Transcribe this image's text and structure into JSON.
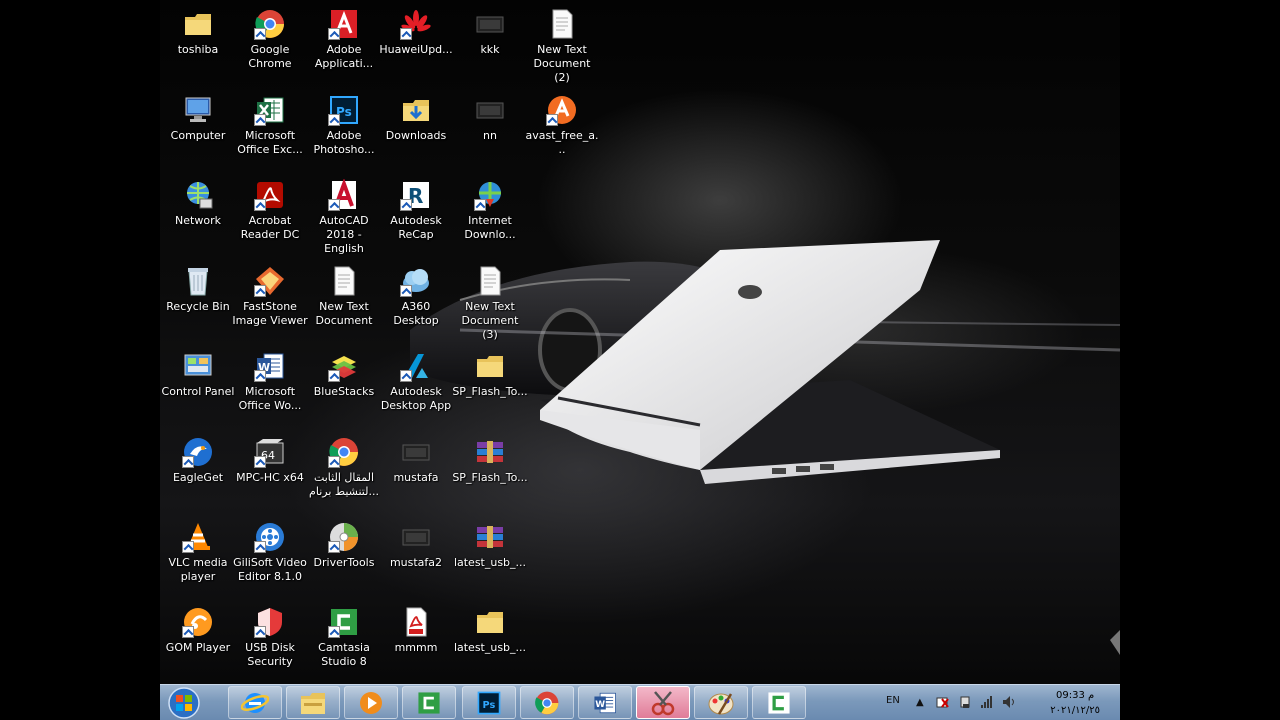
{
  "desktop": {
    "icons": [
      {
        "label": "toshiba",
        "type": "folder-icon"
      },
      {
        "label": "Google Chrome",
        "type": "chrome-icon"
      },
      {
        "label": "Adobe Applicati...",
        "type": "adobe-icon"
      },
      {
        "label": "HuaweiUpd...",
        "type": "huawei-icon"
      },
      {
        "label": "kkk",
        "type": "video-file-icon"
      },
      {
        "label": "New Text Document (2)",
        "type": "text-file-icon"
      },
      {
        "label": "Computer",
        "type": "computer-icon"
      },
      {
        "label": "Microsoft Office Exc...",
        "type": "excel-icon"
      },
      {
        "label": "Adobe Photosho...",
        "type": "photoshop-icon"
      },
      {
        "label": "Downloads",
        "type": "downloads-folder-icon"
      },
      {
        "label": "nn",
        "type": "video-file-icon"
      },
      {
        "label": "avast_free_a...",
        "type": "avast-icon"
      },
      {
        "label": "Network",
        "type": "network-icon"
      },
      {
        "label": "Acrobat Reader DC",
        "type": "acrobat-icon"
      },
      {
        "label": "AutoCAD 2018 - English",
        "type": "autocad-icon"
      },
      {
        "label": "Autodesk ReCap",
        "type": "recap-icon"
      },
      {
        "label": "Internet Downlo...",
        "type": "idm-icon"
      },
      {
        "label": "Recycle Bin",
        "type": "recycle-bin-icon"
      },
      {
        "label": "FastStone Image Viewer",
        "type": "faststone-icon"
      },
      {
        "label": "New Text Document",
        "type": "text-file-icon"
      },
      {
        "label": "A360 Desktop",
        "type": "a360-icon"
      },
      {
        "label": "New Text Document (3)",
        "type": "text-file-icon"
      },
      {
        "label": "Control Panel",
        "type": "control-panel-icon"
      },
      {
        "label": "Microsoft Office Wo...",
        "type": "word-icon"
      },
      {
        "label": "BlueStacks",
        "type": "bluestacks-icon"
      },
      {
        "label": "Autodesk Desktop App",
        "type": "autodesk-app-icon"
      },
      {
        "label": "SP_Flash_To...",
        "type": "folder-icon"
      },
      {
        "label": "EagleGet",
        "type": "eagleget-icon"
      },
      {
        "label": "MPC-HC x64",
        "type": "mpc-icon"
      },
      {
        "label": "المقال الثابت لتنشيط برنام...",
        "type": "chrome-icon"
      },
      {
        "label": "mustafa",
        "type": "video-file-icon"
      },
      {
        "label": "SP_Flash_To...",
        "type": "winrar-icon"
      },
      {
        "label": "VLC media player",
        "type": "vlc-icon"
      },
      {
        "label": "GiliSoft Video Editor 8.1.0",
        "type": "gilisoft-icon"
      },
      {
        "label": "DriverTools",
        "type": "drivertools-icon"
      },
      {
        "label": "mustafa2",
        "type": "video-file-icon"
      },
      {
        "label": "latest_usb_...",
        "type": "winrar-icon"
      },
      {
        "label": "GOM Player",
        "type": "gom-icon"
      },
      {
        "label": "USB Disk Security",
        "type": "usb-security-icon"
      },
      {
        "label": "Camtasia Studio 8",
        "type": "camtasia-icon"
      },
      {
        "label": "mmmm",
        "type": "pdf-icon"
      },
      {
        "label": "latest_usb_...",
        "type": "folder-icon"
      }
    ]
  },
  "taskbar": {
    "pinned": [
      {
        "name": "internet-explorer-icon"
      },
      {
        "name": "explorer-icon"
      },
      {
        "name": "media-player-icon"
      },
      {
        "name": "camtasia-icon"
      },
      {
        "name": "photoshop-icon"
      },
      {
        "name": "chrome-icon"
      },
      {
        "name": "word-icon"
      },
      {
        "name": "snipping-tool-icon",
        "active": true
      },
      {
        "name": "paint-icon"
      },
      {
        "name": "camtasia-recorder-icon"
      }
    ],
    "language": "EN",
    "time": "09:33 م",
    "date": "٢٠٢١/١٢/٢٥"
  }
}
